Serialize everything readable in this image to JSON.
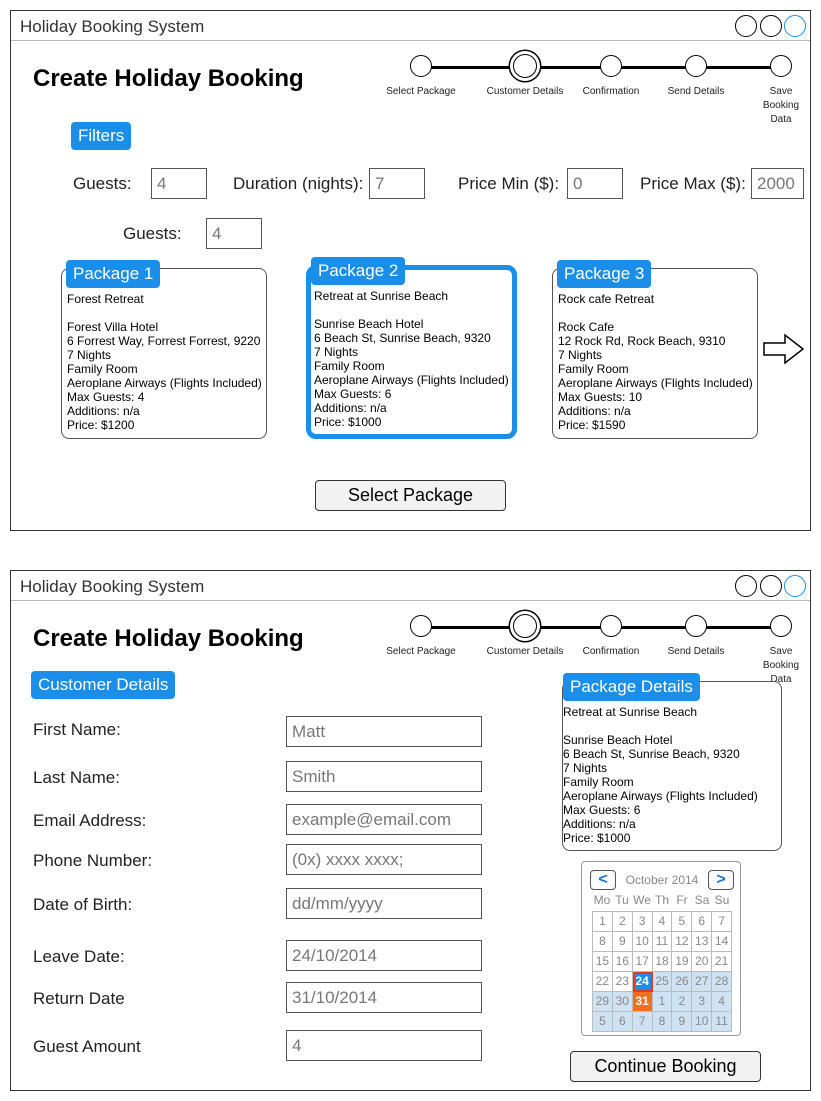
{
  "app_title": "Holiday Booking System",
  "page_title": "Create Holiday Booking",
  "steps": [
    "Select Package",
    "Customer Details",
    "Confirmation",
    "Send Details",
    "Save\nBooking\nData"
  ],
  "screen1": {
    "filters_label": "Filters",
    "filters": {
      "guests_label": "Guests:",
      "guests_value": "4",
      "duration_label": "Duration (nights):",
      "duration_value": "7",
      "price_min_label": "Price Min ($):",
      "price_min_value": "0",
      "price_max_label": "Price Max ($):",
      "price_max_value": "2000",
      "guests2_label": "Guests:",
      "guests2_value": "4"
    },
    "packages": [
      {
        "title": "Package 1",
        "details": "Forest Retreat\n\nForest Villa Hotel\n6 Forrest Way, Forrest Forrest, 9220\n7 Nights\nFamily Room\nAeroplane Airways (Flights Included)\nMax Guests: 4\nAdditions: n/a\nPrice: $1200"
      },
      {
        "title": "Package 2",
        "details": "Retreat at Sunrise Beach\n\nSunrise Beach Hotel\n6 Beach St, Sunrise Beach, 9320\n7 Nights\nFamily Room\nAeroplane Airways (Flights Included)\nMax Guests: 6\nAdditions: n/a\nPrice: $1000"
      },
      {
        "title": "Package 3",
        "details": "Rock cafe Retreat\n\nRock Cafe\n12 Rock Rd, Rock Beach, 9310\n7 Nights\nFamily Room\nAeroplane Airways (Flights Included)\nMax Guests: 10\nAdditions: n/a\nPrice: $1590"
      }
    ],
    "select_button": "Select Package"
  },
  "screen2": {
    "section_label": "Customer Details",
    "fields": [
      {
        "label": "First Name:",
        "value": "Matt"
      },
      {
        "label": "Last Name:",
        "value": "Smith"
      },
      {
        "label": "Email Address:",
        "value": "example@email.com"
      },
      {
        "label": "Phone Number:",
        "value": "(0x) xxxx xxxx;"
      },
      {
        "label": "Date of Birth:",
        "value": "dd/mm/yyyy"
      },
      {
        "label": "Leave Date:",
        "value": "24/10/2014"
      },
      {
        "label": "Return Date",
        "value": "31/10/2014"
      },
      {
        "label": "Guest Amount",
        "value": "4"
      }
    ],
    "package_details_label": "Package Details",
    "package_details": "Retreat at Sunrise Beach\n\nSunrise Beach Hotel\n6 Beach St, Sunrise Beach, 9320\n7 Nights\nFamily Room\nAeroplane Airways (Flights Included)\nMax Guests: 6\nAdditions: n/a\nPrice: $1000",
    "calendar": {
      "prev": "<",
      "next": ">",
      "month": "October 2014",
      "dow": [
        "Mo",
        "Tu",
        "We",
        "Th",
        "Fr",
        "Sa",
        "Su"
      ],
      "weeks": [
        [
          "1",
          "2",
          "3",
          "4",
          "5",
          "6",
          "7"
        ],
        [
          "8",
          "9",
          "10",
          "11",
          "12",
          "13",
          "14"
        ],
        [
          "15",
          "16",
          "17",
          "18",
          "19",
          "20",
          "21"
        ],
        [
          "22",
          "23",
          "24",
          "25",
          "26",
          "27",
          "28"
        ],
        [
          "29",
          "30",
          "31",
          "1",
          "2",
          "3",
          "4"
        ],
        [
          "5",
          "6",
          "7",
          "8",
          "9",
          "10",
          "11"
        ]
      ],
      "start_day": "24",
      "end_day": "31"
    },
    "continue_button": "Continue Booking"
  },
  "colors": {
    "accent": "#1a8ee8",
    "range": "#cfe2f3",
    "end_day": "#f07020"
  }
}
